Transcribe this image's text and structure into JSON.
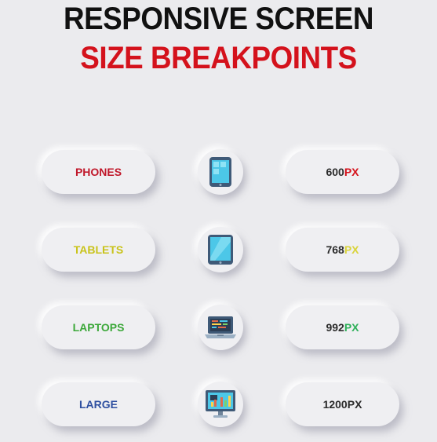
{
  "title": {
    "line1": "RESPONSIVE SCREEN",
    "line2": "SIZE BREAKPOINTS"
  },
  "rows": [
    {
      "device": "PHONES",
      "device_color": "#c0172a",
      "icon": "phone-icon",
      "value": "600",
      "unit": "PX",
      "unit_color": "#d4121c"
    },
    {
      "device": "TABLETS",
      "device_color": "#c9c31a",
      "icon": "tablet-icon",
      "value": "768",
      "unit": "PX",
      "unit_color": "#d9d33a"
    },
    {
      "device": "LAPTOPS",
      "device_color": "#3ca83a",
      "icon": "laptop-icon",
      "value": "992",
      "unit": "PX",
      "unit_color": "#2fb05a"
    },
    {
      "device": "LARGE",
      "device_color": "#2e4fa0",
      "icon": "desktop-icon",
      "value": "1200",
      "unit": "PX",
      "unit_color": "#2b2b2b"
    }
  ]
}
